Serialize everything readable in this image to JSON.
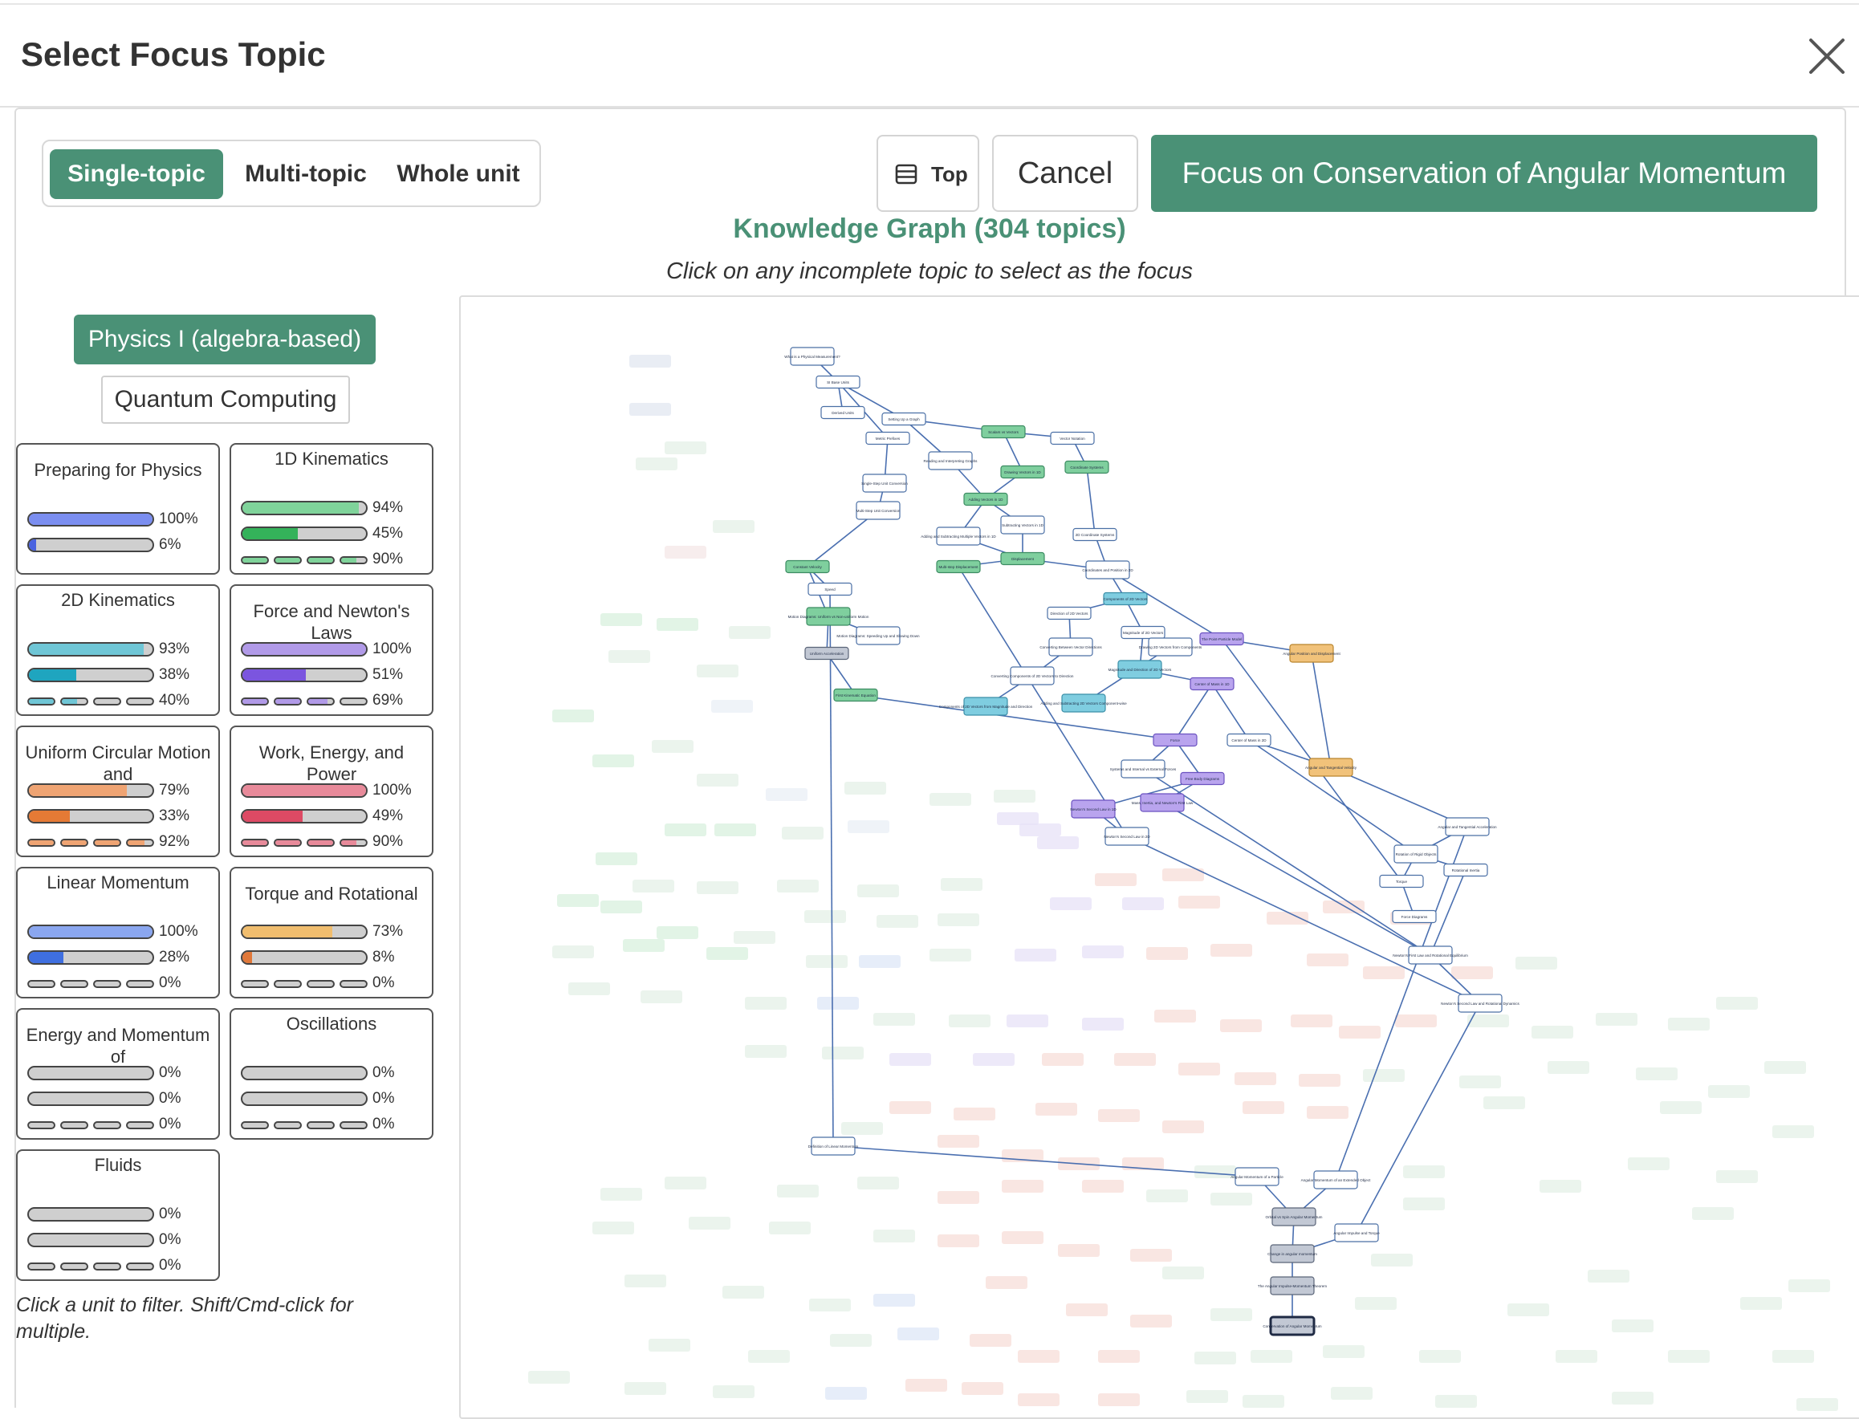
{
  "header": {
    "title": "Select Focus Topic",
    "close_icon": "close-icon"
  },
  "modes": [
    {
      "label": "Single-topic",
      "active": true
    },
    {
      "label": "Multi-topic",
      "active": false
    },
    {
      "label": "Whole unit",
      "active": false
    }
  ],
  "toolbar": {
    "top_label": "Top",
    "top_icon": "list-icon",
    "cancel_label": "Cancel",
    "focus_label": "Focus on Conservation of Angular Momentum"
  },
  "graph": {
    "title": "Knowledge Graph (304 topics)",
    "subtitle": "Click on any incomplete topic to select as the focus"
  },
  "courses": [
    {
      "label": "Physics I (algebra-based)",
      "selected": true
    },
    {
      "label": "Quantum Computing",
      "selected": false
    }
  ],
  "units": [
    {
      "name": "Preparing for Physics",
      "color": "#7b8ef0",
      "dark": "#4a63e0",
      "bars": [
        {
          "value": 100,
          "label": "100%"
        },
        {
          "value": 6,
          "label": "6%"
        }
      ]
    },
    {
      "name": "1D Kinematics",
      "color": "#7fd39a",
      "dark": "#34b25a",
      "bars": [
        {
          "value": 94,
          "label": "94%"
        },
        {
          "value": 45,
          "label": "45%"
        },
        {
          "value": 90,
          "label": "90%",
          "segmented": true
        }
      ]
    },
    {
      "name": "2D Kinematics",
      "color": "#6fc6d6",
      "dark": "#1fa5bf",
      "bars": [
        {
          "value": 93,
          "label": "93%"
        },
        {
          "value": 38,
          "label": "38%"
        },
        {
          "value": 40,
          "label": "40%",
          "segmented": true
        }
      ]
    },
    {
      "name": "Force and Newton's Laws",
      "color": "#b19ae8",
      "dark": "#7b55df",
      "bars": [
        {
          "value": 100,
          "label": "100%"
        },
        {
          "value": 51,
          "label": "51%"
        },
        {
          "value": 69,
          "label": "69%",
          "segmented": true
        }
      ]
    },
    {
      "name": "Uniform Circular Motion and",
      "color": "#efa473",
      "dark": "#e57a35",
      "bars": [
        {
          "value": 79,
          "label": "79%"
        },
        {
          "value": 33,
          "label": "33%"
        },
        {
          "value": 92,
          "label": "92%",
          "segmented": true
        }
      ]
    },
    {
      "name": "Work, Energy, and Power",
      "color": "#e88a9a",
      "dark": "#dd4a64",
      "bars": [
        {
          "value": 100,
          "label": "100%"
        },
        {
          "value": 49,
          "label": "49%"
        },
        {
          "value": 90,
          "label": "90%",
          "segmented": true
        }
      ]
    },
    {
      "name": "Linear Momentum",
      "color": "#8aa6ef",
      "dark": "#3f6fe0",
      "bars": [
        {
          "value": 100,
          "label": "100%"
        },
        {
          "value": 28,
          "label": "28%"
        },
        {
          "value": 0,
          "label": "0%",
          "segmented": true
        }
      ]
    },
    {
      "name": "Torque and Rotational",
      "color": "#f0bd6e",
      "dark": "#e0783a",
      "bars": [
        {
          "value": 73,
          "label": "73%"
        },
        {
          "value": 8,
          "label": "8%"
        },
        {
          "value": 0,
          "label": "0%",
          "segmented": true
        }
      ]
    },
    {
      "name": "Energy and Momentum of",
      "color": "#9ab0e0",
      "dark": "#5a7fd0",
      "bars": [
        {
          "value": 0,
          "label": "0%"
        },
        {
          "value": 0,
          "label": "0%"
        },
        {
          "value": 0,
          "label": "0%",
          "segmented": true
        }
      ]
    },
    {
      "name": "Oscillations",
      "color": "#b0b0b0",
      "dark": "#888888",
      "bars": [
        {
          "value": 0,
          "label": "0%"
        },
        {
          "value": 0,
          "label": "0%"
        },
        {
          "value": 0,
          "label": "0%",
          "segmented": true
        }
      ]
    },
    {
      "name": "Fluids",
      "color": "#b0b0b0",
      "dark": "#888888",
      "bars": [
        {
          "value": 0,
          "label": "0%"
        },
        {
          "value": 0,
          "label": "0%"
        },
        {
          "value": 0,
          "label": "0%",
          "segmented": true
        }
      ]
    }
  ],
  "hint": "Click a unit to filter. Shift/Cmd-click for multiple.",
  "graph_nodes": [
    {
      "label": "What is a Physical Measurement?",
      "state": "open"
    },
    {
      "label": "SI Base Units",
      "state": "open"
    },
    {
      "label": "Derived Units",
      "state": "open"
    },
    {
      "label": "Setting Up a Graph",
      "state": "open"
    },
    {
      "label": "Metric Prefixes",
      "state": "open"
    },
    {
      "label": "Reading and Interpreting Graphs",
      "state": "open"
    },
    {
      "label": "Scalars vs Vectors",
      "state": "green"
    },
    {
      "label": "Vector Notation",
      "state": "open"
    },
    {
      "label": "Drawing Vectors in 1D",
      "state": "green"
    },
    {
      "label": "Coordinate Systems",
      "state": "green"
    },
    {
      "label": "Single-Step Unit Conversion",
      "state": "open"
    },
    {
      "label": "Adding Vectors in 1D",
      "state": "green"
    },
    {
      "label": "Multi-Step Unit Conversion",
      "state": "open"
    },
    {
      "label": "Subtracting Vectors in 1D",
      "state": "open"
    },
    {
      "label": "2D Coordinate Systems",
      "state": "open"
    },
    {
      "label": "Adding and Subtracting Multiple Vectors in 1D",
      "state": "open"
    },
    {
      "label": "Displacement",
      "state": "green"
    },
    {
      "label": "Constant Velocity",
      "state": "green"
    },
    {
      "label": "Multi-step Displacement",
      "state": "green"
    },
    {
      "label": "Coordinates and Position in 2D",
      "state": "open"
    },
    {
      "label": "Speed",
      "state": "open"
    },
    {
      "label": "Components of 2D Vectors",
      "state": "teal"
    },
    {
      "label": "Motion Diagrams: Uniform vs Non-uniform Motion",
      "state": "green"
    },
    {
      "label": "Motion Diagrams: Speeding Up and Slowing Down",
      "state": "open"
    },
    {
      "label": "Direction of 2D Vectors",
      "state": "open"
    },
    {
      "label": "Magnitude of 2D Vectors",
      "state": "open"
    },
    {
      "label": "The Point-Particle Model",
      "state": "purple"
    },
    {
      "label": "Angular Position and Displacement",
      "state": "orange"
    },
    {
      "label": "Uniform Acceleration",
      "state": "gray"
    },
    {
      "label": "Converting Between Vector Directions",
      "state": "open"
    },
    {
      "label": "Drawing 2D Vectors from Components",
      "state": "open"
    },
    {
      "label": "Magnitude and Direction of 2D Vectors",
      "state": "teal"
    },
    {
      "label": "Center of Mass in 1D",
      "state": "purple"
    },
    {
      "label": "First Kinematic Equation",
      "state": "green"
    },
    {
      "label": "Converting Components of 2D Vectors to Direction",
      "state": "open"
    },
    {
      "label": "Components of 2D Vectors from Magnitude and Direction",
      "state": "teal"
    },
    {
      "label": "Adding and Subtracting 2D Vectors Component-wise",
      "state": "teal"
    },
    {
      "label": "Force",
      "state": "purple"
    },
    {
      "label": "Center of Mass in 2D",
      "state": "open"
    },
    {
      "label": "Systems and Internal vs External Forces",
      "state": "open"
    },
    {
      "label": "Free Body Diagrams",
      "state": "purple"
    },
    {
      "label": "Angular and Tangential Velocity",
      "state": "orange"
    },
    {
      "label": "Mass, Inertia, and Newton's First Law",
      "state": "purple"
    },
    {
      "label": "Newton's Second Law in 1D",
      "state": "purple"
    },
    {
      "label": "Newton's Second Law in 2D",
      "state": "open"
    },
    {
      "label": "Angular and Tangential Acceleration",
      "state": "open"
    },
    {
      "label": "Rotation of Rigid Objects",
      "state": "open"
    },
    {
      "label": "Rotational Inertia",
      "state": "open"
    },
    {
      "label": "Torque",
      "state": "open"
    },
    {
      "label": "Force Diagrams",
      "state": "open"
    },
    {
      "label": "Newton's First Law and Rotational Equilibrium",
      "state": "open"
    },
    {
      "label": "Newton's Second Law and Rotational Dynamics",
      "state": "open"
    },
    {
      "label": "Definition of Linear Momentum",
      "state": "open"
    },
    {
      "label": "Angular Momentum of a Particle",
      "state": "open"
    },
    {
      "label": "Angular Momentum of an Extended Object",
      "state": "open"
    },
    {
      "label": "Orbital vs Spin Angular Momentum",
      "state": "gray"
    },
    {
      "label": "Angular Impulse and Torque",
      "state": "open"
    },
    {
      "label": "Change in angular momentum",
      "state": "gray"
    },
    {
      "label": "The Angular Impulse-Momentum Theorem",
      "state": "gray"
    },
    {
      "label": "Conservation of Angular Momentum",
      "state": "focus"
    }
  ]
}
